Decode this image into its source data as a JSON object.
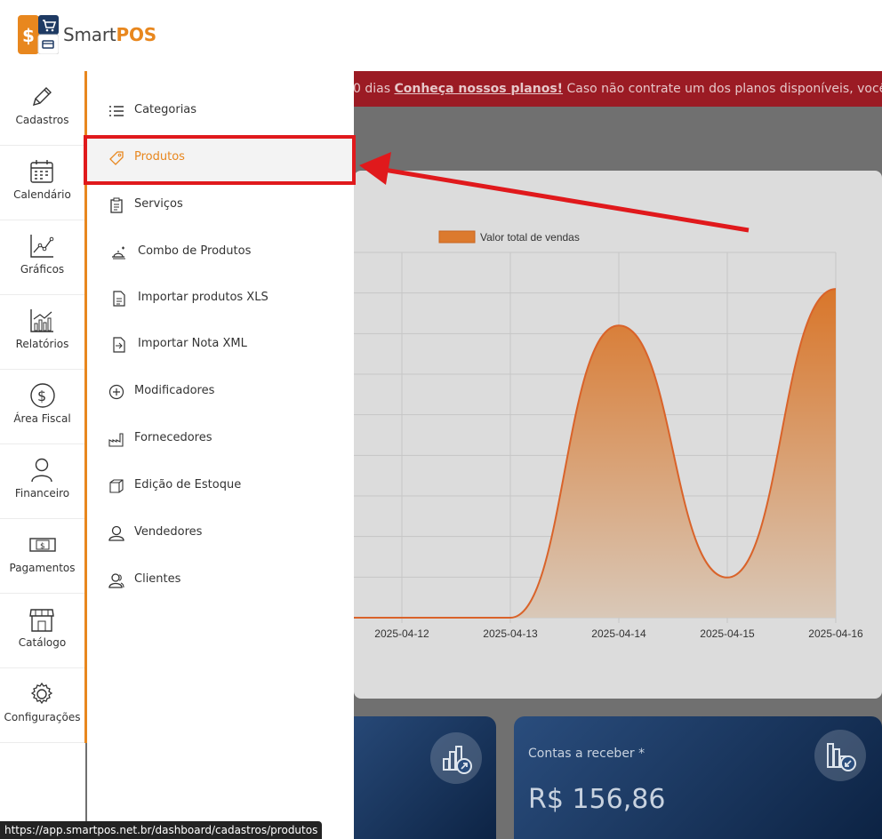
{
  "app": {
    "brand_light": "Smart",
    "brand_bold": "POS"
  },
  "banner": {
    "pre": "0 dias ",
    "link": "Conheça nossos planos!",
    "post": " Caso não contrate um dos planos disponíveis, você contará a"
  },
  "rail": {
    "items": [
      {
        "label": "Cadastros",
        "icon": "pencil-icon"
      },
      {
        "label": "Calendário",
        "icon": "calendar-icon"
      },
      {
        "label": "Gráficos",
        "icon": "line-chart-icon"
      },
      {
        "label": "Relatórios",
        "icon": "bar-report-icon"
      },
      {
        "label": "Área Fiscal",
        "icon": "dollar-circle-icon"
      },
      {
        "label": "Financeiro",
        "icon": "person-icon"
      },
      {
        "label": "Pagamentos",
        "icon": "banknote-icon"
      },
      {
        "label": "Catálogo",
        "icon": "storefront-icon"
      },
      {
        "label": "Configurações",
        "icon": "gear-icon"
      }
    ]
  },
  "submenu": {
    "items": [
      {
        "label": "Categorias",
        "icon": "list-icon"
      },
      {
        "label": "Produtos",
        "icon": "tag-icon",
        "active": true
      },
      {
        "label": "Serviços",
        "icon": "clipboard-icon"
      },
      {
        "label": "Combo de Produtos",
        "icon": "combo-icon"
      },
      {
        "label": "Importar produtos XLS",
        "icon": "file-import-icon"
      },
      {
        "label": "Importar Nota XML",
        "icon": "file-arrow-icon"
      },
      {
        "label": "Modificadores",
        "icon": "plus-circle-icon"
      },
      {
        "label": "Fornecedores",
        "icon": "factory-icon"
      },
      {
        "label": "Edição de Estoque",
        "icon": "box-icon"
      },
      {
        "label": "Vendedores",
        "icon": "user-icon"
      },
      {
        "label": "Clientes",
        "icon": "users-icon"
      }
    ]
  },
  "chart_data": {
    "type": "area",
    "legend": "Valor total de vendas",
    "categories": [
      "2025-04-12",
      "2025-04-13",
      "2025-04-14",
      "2025-04-15",
      "2025-04-16"
    ],
    "values": [
      0,
      0,
      0.8,
      0.11,
      0.9
    ],
    "series_color": "#e07b2c",
    "grid": true
  },
  "cards": {
    "receivable_title": "Contas a receber *",
    "receivable_value": "R$ 156,86"
  },
  "status_bar": {
    "url": "https://app.smartpos.net.br/dashboard/cadastros/produtos"
  },
  "colors": {
    "accent": "#e8871e",
    "banner": "#c1272d",
    "highlight": "#e0191c",
    "card": "#1e3a63"
  }
}
